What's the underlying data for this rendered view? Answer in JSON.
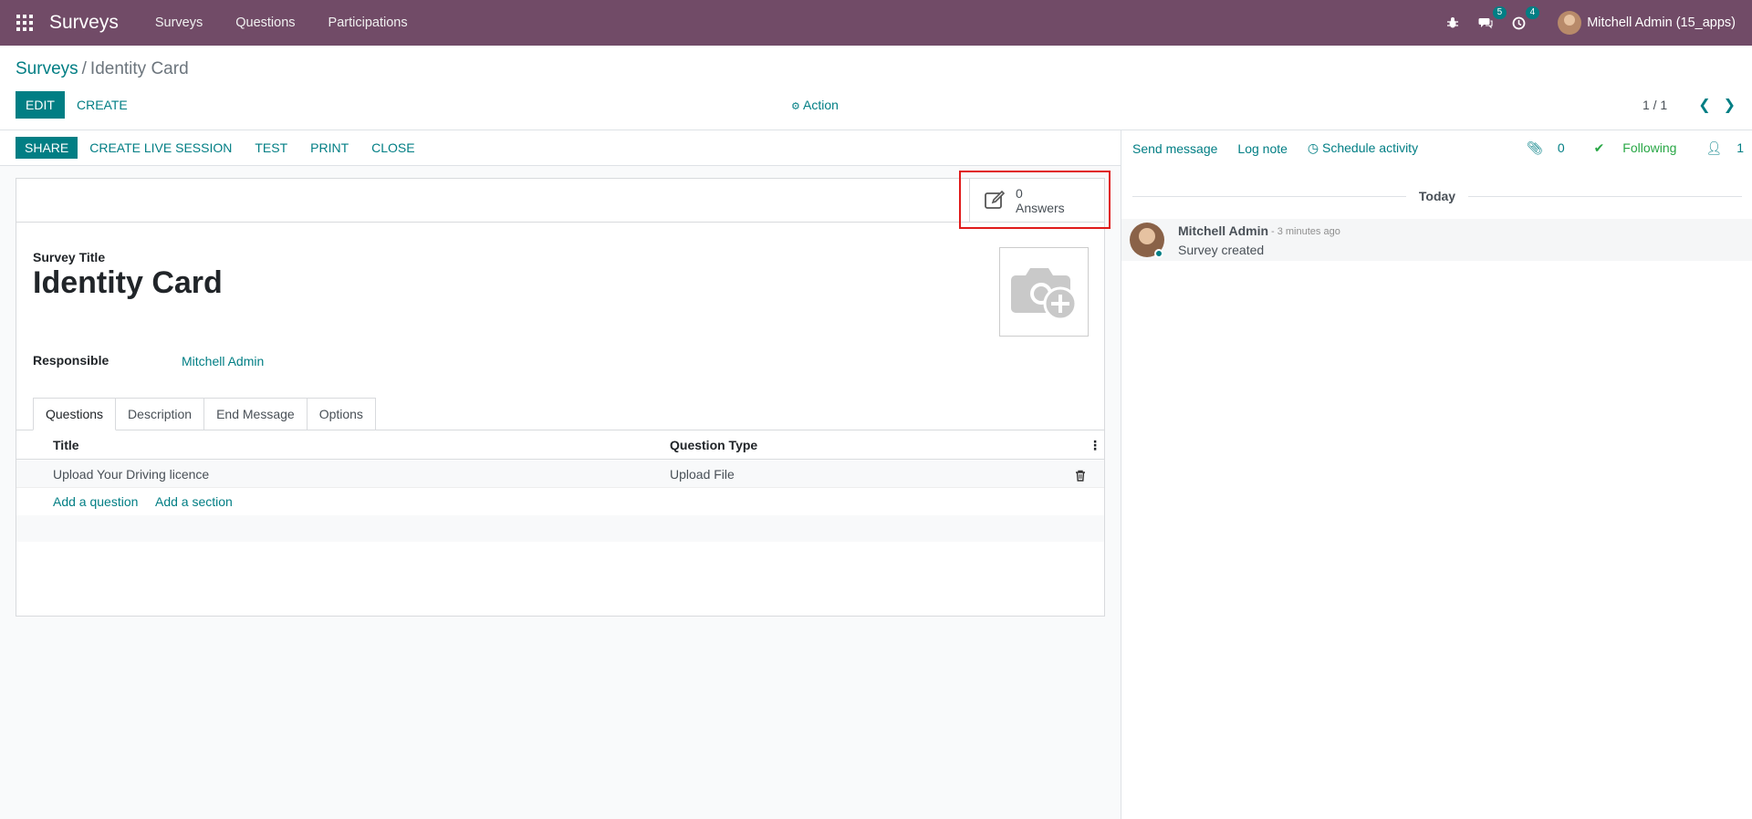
{
  "navbar": {
    "brand": "Surveys",
    "menu": [
      "Surveys",
      "Questions",
      "Participations"
    ],
    "messages_count": "5",
    "activities_count": "4",
    "user": "Mitchell Admin (15_apps)"
  },
  "breadcrumb": {
    "parent": "Surveys",
    "separator": "/",
    "current": "Identity Card"
  },
  "control": {
    "edit": "EDIT",
    "create": "CREATE",
    "action": "Action",
    "pager": "1 / 1"
  },
  "statusbar": {
    "buttons": [
      "SHARE",
      "CREATE LIVE SESSION",
      "TEST",
      "PRINT",
      "CLOSE"
    ]
  },
  "stat_button": {
    "value": "0",
    "label": "Answers"
  },
  "form": {
    "title_label": "Survey Title",
    "title": "Identity Card",
    "responsible_label": "Responsible",
    "responsible": "Mitchell Admin"
  },
  "tabs": [
    "Questions",
    "Description",
    "End Message",
    "Options"
  ],
  "table": {
    "headers": [
      "Title",
      "Question Type"
    ],
    "rows": [
      {
        "title": "Upload Your Driving licence",
        "type": "Upload File"
      }
    ],
    "add_question": "Add a question",
    "add_section": "Add a section"
  },
  "chatter": {
    "send_message": "Send message",
    "log_note": "Log note",
    "schedule_activity": "Schedule activity",
    "attachments": "0",
    "following": "Following",
    "followers": "1",
    "today": "Today",
    "message": {
      "author": "Mitchell Admin",
      "date": "- 3 minutes ago",
      "body": "Survey created"
    }
  },
  "colors": {
    "brand": "#714B67",
    "accent": "#017e84",
    "highlight": "#e01b1b",
    "following": "#28a745"
  }
}
